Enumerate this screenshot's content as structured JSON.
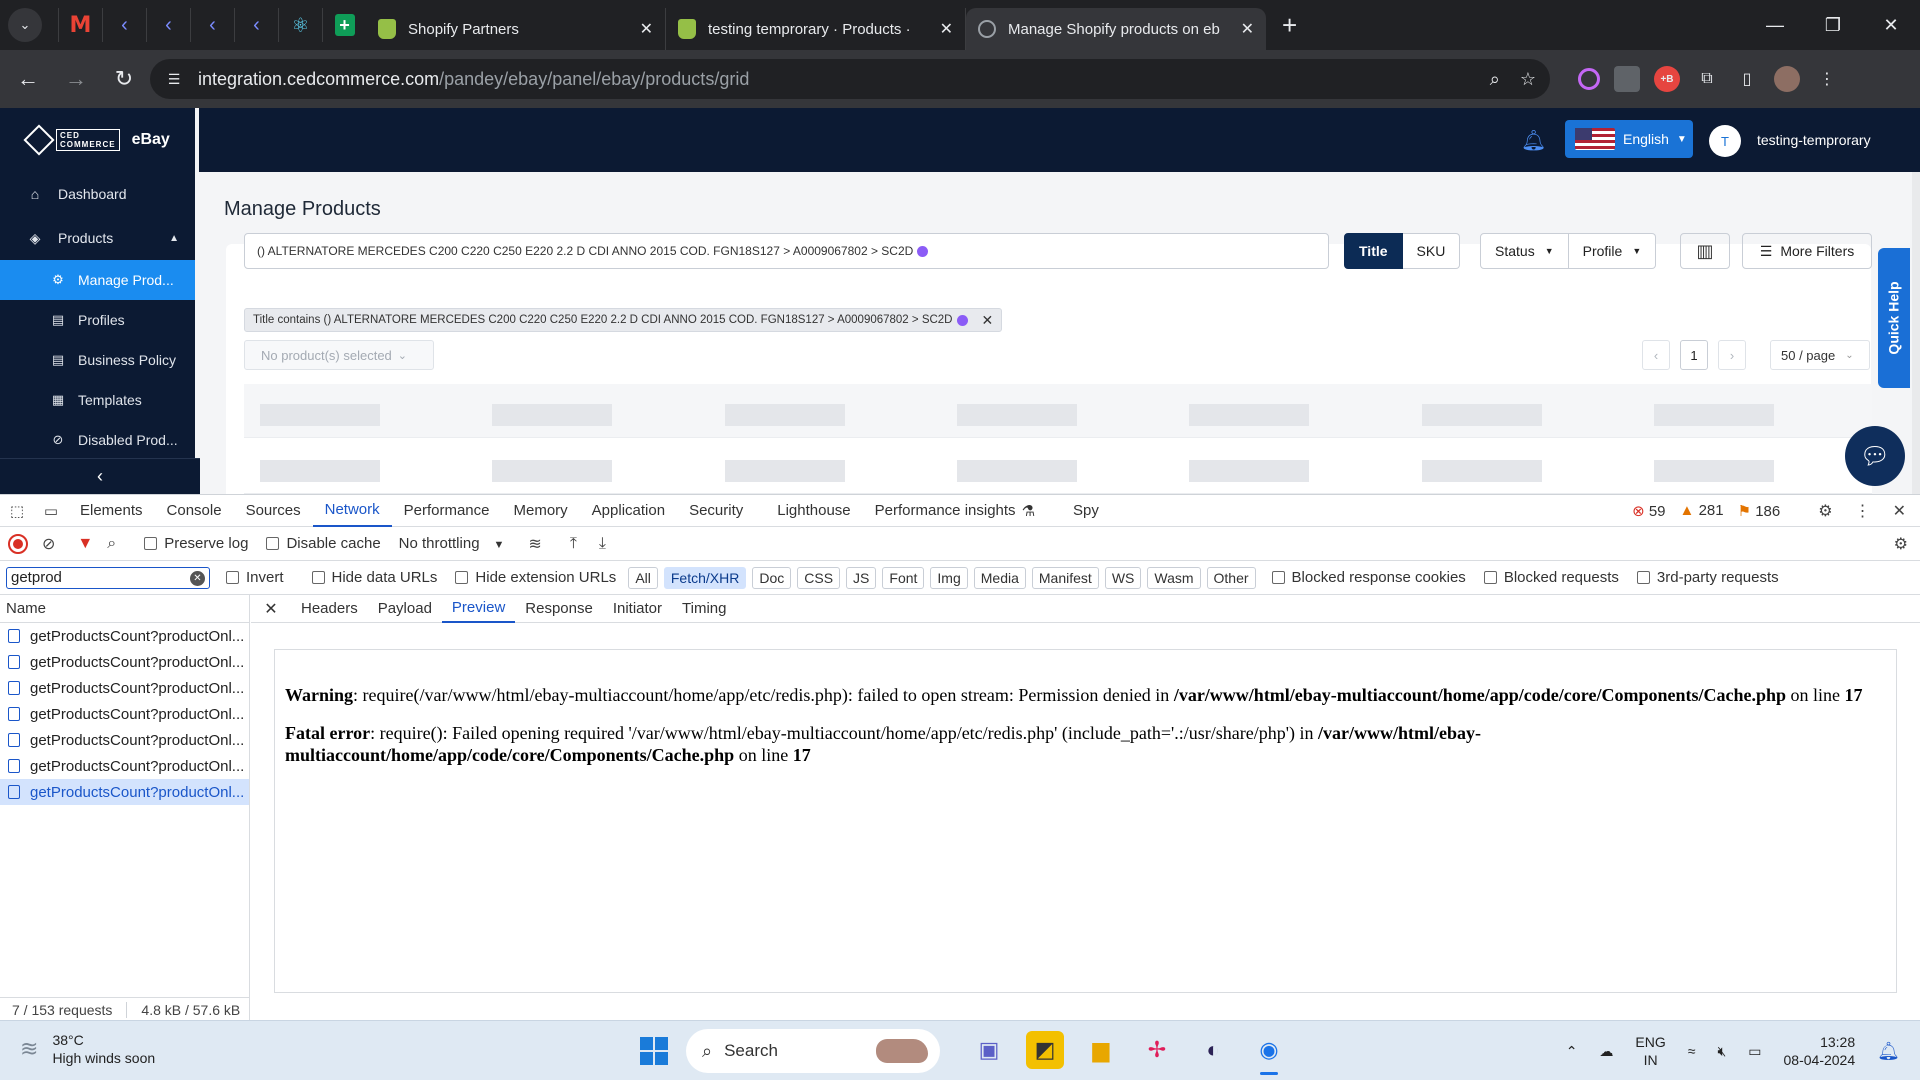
{
  "browser": {
    "tabs": [
      {
        "title": "Shopify Partners"
      },
      {
        "title": "testing temprorary · Products · "
      },
      {
        "title": "Manage Shopify products on eb"
      }
    ],
    "url_host": "integration.cedcommerce.com",
    "url_path": "/pandey/ebay/panel/ebay/products/grid"
  },
  "app": {
    "brand_box": "CED\nCOMMERCE",
    "brand_name": "eBay",
    "nav": {
      "dashboard": "Dashboard",
      "products": "Products",
      "manage_products": "Manage Prod...",
      "profiles": "Profiles",
      "business_policy": "Business Policy",
      "templates": "Templates",
      "disabled_products": "Disabled Prod..."
    },
    "language": "English",
    "user_initial": "T",
    "user_name": "testing-temprorary",
    "page_title": "Manage Products",
    "search_value": "() ALTERNATORE MERCEDES C200 C220 C250 E220 2.2 D CDI ANNO 2015 COD. FGN18S127 > A0009067802 > SC2D",
    "btn_title": "Title",
    "btn_sku": "SKU",
    "btn_status": "Status",
    "btn_profile": "Profile",
    "btn_more_filters": "More Filters",
    "filter_tag": "Title contains () ALTERNATORE MERCEDES C200 C220 C250 E220 2.2 D CDI ANNO 2015 COD. FGN18S127 > A0009067802 > SC2D",
    "selected_placeholder": "No product(s) selected",
    "page_number": "1",
    "per_page": "50 / page",
    "quick_help": "Quick Help"
  },
  "devtools": {
    "tabs": [
      "Elements",
      "Console",
      "Sources",
      "Network",
      "Performance",
      "Memory",
      "Application",
      "Security",
      "Lighthouse",
      "Performance insights",
      "Spy"
    ],
    "errors": "59",
    "warnings": "281",
    "issues": "186",
    "preserve_log": "Preserve log",
    "disable_cache": "Disable cache",
    "throttling": "No throttling",
    "filter_value": "getprod",
    "invert": "Invert",
    "hide_data_urls": "Hide data URLs",
    "hide_ext_urls": "Hide extension URLs",
    "type_chips": [
      "All",
      "Fetch/XHR",
      "Doc",
      "CSS",
      "JS",
      "Font",
      "Img",
      "Media",
      "Manifest",
      "WS",
      "Wasm",
      "Other"
    ],
    "blocked_cookies": "Blocked response cookies",
    "blocked_requests": "Blocked requests",
    "third_party": "3rd-party requests",
    "name_header": "Name",
    "requests": [
      "getProductsCount?productOnl...",
      "getProductsCount?productOnl...",
      "getProductsCount?productOnl...",
      "getProductsCount?productOnl...",
      "getProductsCount?productOnl...",
      "getProductsCount?productOnl...",
      "getProductsCount?productOnl..."
    ],
    "request_count": "7 / 153 requests",
    "transfer": "4.8 kB / 57.6 kB",
    "detail_tabs": [
      "Headers",
      "Payload",
      "Preview",
      "Response",
      "Initiator",
      "Timing"
    ],
    "preview": {
      "warning_label": "Warning",
      "warning_text": ": require(/var/www/html/ebay-multiaccount/home/app/etc/redis.php): failed to open stream: Permission denied in ",
      "warning_file": "/var/www/html/ebay-multiaccount/home/app/code/core/Components/Cache.php",
      "warning_online": " on line ",
      "warning_line": "17",
      "fatal_label": "Fatal error",
      "fatal_text": ": require(): Failed opening required '/var/www/html/ebay-multiaccount/home/app/etc/redis.php' (include_path='.:/usr/share/php') in ",
      "fatal_file": "/var/www/html/ebay-multiaccount/home/app/code/core/Components/Cache.php",
      "fatal_online": " on line ",
      "fatal_line": "17"
    }
  },
  "taskbar": {
    "temperature": "38°C",
    "weather": "High winds soon",
    "search": "Search",
    "lang_top": "ENG",
    "lang_bottom": "IN",
    "time": "13:28",
    "date": "08-04-2024"
  }
}
